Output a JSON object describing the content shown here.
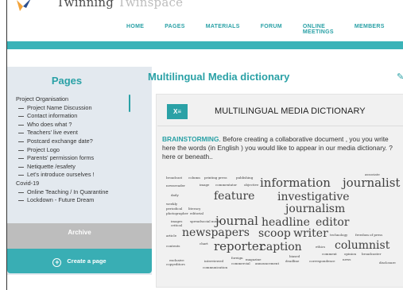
{
  "header": {
    "logo_text_dark": "Twinning ",
    "logo_text_light": "Twinspace",
    "nav": [
      "HOME",
      "PAGES",
      "MATERIALS",
      "FORUM",
      "ONLINE MEETINGS",
      "MEMBERS"
    ]
  },
  "sidebar": {
    "title": "Pages",
    "sections": [
      {
        "label": "Project Organisation",
        "items": [
          "Project Name Discussion",
          "Contact information",
          "Who does what ?",
          "Teachers' live event",
          "Postcard exchange date?",
          "Project Logo",
          "Parents' permission forms",
          "Netiquette /esafety",
          "Let's introduce ourselves !"
        ]
      },
      {
        "label": "Covid-19",
        "items": [
          "Online Teaching / In Quarantine",
          "Lockdown - Future Dream"
        ]
      }
    ],
    "archive_label": "Archive",
    "create_label": "Create a page"
  },
  "main": {
    "title": "Multilingual Media dictionary",
    "card": {
      "icon_label": "x",
      "title": "MULTILINGUAL MEDIA DICTIONARY",
      "keyword": "BRAINSTORMING",
      "text": ". Before creating a collaborative document , you you write here the words (in English ) you would like to appear in our media dictionary. ?  here or beneath.."
    },
    "wordcloud": [
      "broadcast",
      "column",
      "printing press",
      "publishing",
      "associate",
      "newsreader",
      "image",
      "commentator",
      "objective",
      "information",
      "journalist",
      "daily",
      "feature",
      "investigative",
      "weekly",
      "periodical",
      "literacy",
      "journalism",
      "photographer",
      "editorial",
      "images",
      "critical",
      "spread",
      "social media",
      "journal",
      "headline",
      "editor",
      "article",
      "newspapers",
      "scoop",
      "writer",
      "technology",
      "freedom of press",
      "contents",
      "chart",
      "reporter",
      "caption",
      "ethics",
      "columnist",
      "comment",
      "opinion",
      "broadcaster",
      "biased",
      "exclusive",
      "copyeditors",
      "interviewed",
      "foreign",
      "magazine",
      "commercial",
      "announcement",
      "deadline",
      "correspondence",
      "news",
      "disclosure",
      "communication"
    ],
    "accent_color": "#2aa1a6"
  }
}
